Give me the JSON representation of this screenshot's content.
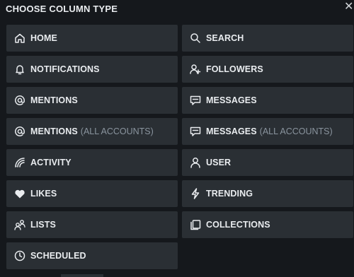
{
  "title": "CHOOSE COLUMN TYPE",
  "close_icon": "close-icon",
  "tiles": [
    {
      "label": "HOME",
      "icon": "home-icon"
    },
    {
      "label": "SEARCH",
      "icon": "search-icon"
    },
    {
      "label": "NOTIFICATIONS",
      "icon": "bell-icon"
    },
    {
      "label": "FOLLOWERS",
      "icon": "add-user-icon"
    },
    {
      "label": "MENTIONS",
      "icon": "at-icon"
    },
    {
      "label": "MESSAGES",
      "icon": "message-icon"
    },
    {
      "label": "MENTIONS",
      "sub": "(ALL ACCOUNTS)",
      "icon": "at-icon"
    },
    {
      "label": "MESSAGES",
      "sub": "(ALL ACCOUNTS)",
      "icon": "message-icon"
    },
    {
      "label": "ACTIVITY",
      "icon": "activity-icon"
    },
    {
      "label": "USER",
      "icon": "user-icon"
    },
    {
      "label": "LIKES",
      "icon": "heart-icon"
    },
    {
      "label": "TRENDING",
      "icon": "lightning-icon"
    },
    {
      "label": "LISTS",
      "icon": "lists-icon"
    },
    {
      "label": "COLLECTIONS",
      "icon": "collections-icon"
    },
    {
      "label": "SCHEDULED",
      "icon": "clock-icon"
    }
  ],
  "colors": {
    "background": "#15181c",
    "tile": "#2a2f34",
    "text": "#e9ecef",
    "muted": "#8a949e"
  }
}
